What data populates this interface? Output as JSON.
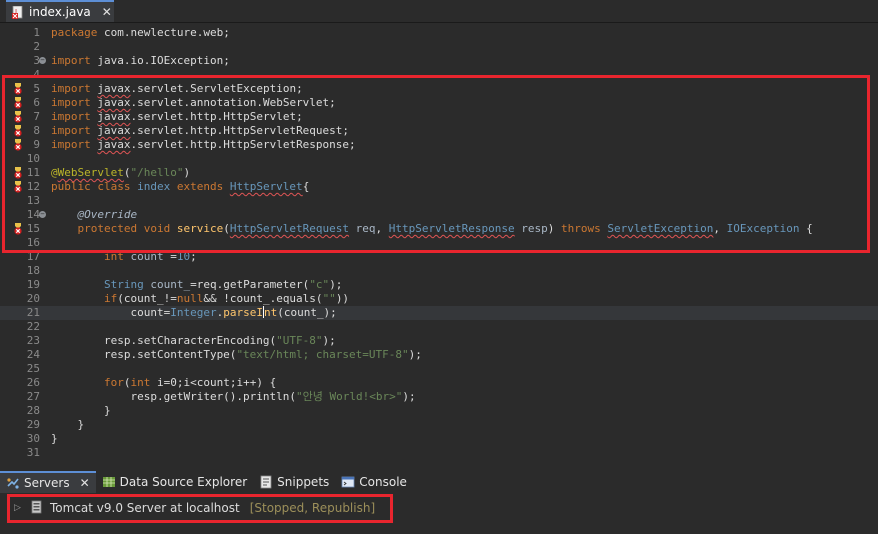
{
  "editor_tab": {
    "filename": "index.java"
  },
  "code_lines": [
    {
      "n": "1",
      "segs": [
        [
          "kw",
          "package"
        ],
        [
          "plain",
          " com.newlecture.web;"
        ]
      ]
    },
    {
      "n": "2",
      "segs": []
    },
    {
      "n": "3",
      "fold": true,
      "segs": [
        [
          "kw",
          "import"
        ],
        [
          "plain",
          " java.io.IOException;"
        ]
      ]
    },
    {
      "n": "4",
      "segs": []
    },
    {
      "n": "5",
      "err": true,
      "segs": [
        [
          "kw",
          "import"
        ],
        [
          "plain",
          " "
        ],
        [
          "plain_squig",
          "javax"
        ],
        [
          "plain",
          ".servlet.ServletException;"
        ]
      ]
    },
    {
      "n": "6",
      "err": true,
      "segs": [
        [
          "kw",
          "import"
        ],
        [
          "plain",
          " "
        ],
        [
          "plain_squig",
          "javax"
        ],
        [
          "plain",
          ".servlet.annotation.WebServlet;"
        ]
      ]
    },
    {
      "n": "7",
      "err": true,
      "segs": [
        [
          "kw",
          "import"
        ],
        [
          "plain",
          " "
        ],
        [
          "plain_squig",
          "javax"
        ],
        [
          "plain",
          ".servlet.http.HttpServlet;"
        ]
      ]
    },
    {
      "n": "8",
      "err": true,
      "segs": [
        [
          "kw",
          "import"
        ],
        [
          "plain",
          " "
        ],
        [
          "plain_squig",
          "javax"
        ],
        [
          "plain",
          ".servlet.http.HttpServletRequest;"
        ]
      ]
    },
    {
      "n": "9",
      "err": true,
      "segs": [
        [
          "kw",
          "import"
        ],
        [
          "plain",
          " "
        ],
        [
          "plain_squig",
          "javax"
        ],
        [
          "plain",
          ".servlet.http.HttpServletResponse;"
        ]
      ]
    },
    {
      "n": "10",
      "segs": []
    },
    {
      "n": "11",
      "err": true,
      "segs": [
        [
          "ann",
          "@"
        ],
        [
          "ann_squig",
          "WebServlet"
        ],
        [
          "plain",
          "("
        ],
        [
          "str",
          "\"/hello\""
        ],
        [
          "plain",
          ")"
        ]
      ]
    },
    {
      "n": "12",
      "err": true,
      "segs": [
        [
          "kw",
          "public class "
        ],
        [
          "type",
          "index"
        ],
        [
          "kw",
          " extends "
        ],
        [
          "type_squig",
          "HttpServlet"
        ],
        [
          "plain",
          "{"
        ]
      ]
    },
    {
      "n": "13",
      "segs": []
    },
    {
      "n": "14",
      "fold": true,
      "segs": [
        [
          "plain",
          "    "
        ],
        [
          "ital",
          "@Override"
        ]
      ]
    },
    {
      "n": "15",
      "err": true,
      "segs": [
        [
          "kw",
          "    protected void "
        ],
        [
          "meth",
          "service"
        ],
        [
          "plain",
          "("
        ],
        [
          "type_squig",
          "HttpServletRequest"
        ],
        [
          "var",
          " req"
        ],
        [
          "plain",
          ", "
        ],
        [
          "type_squig",
          "HttpServletResponse"
        ],
        [
          "var",
          " resp"
        ],
        [
          "plain",
          ") "
        ],
        [
          "kw",
          "throws "
        ],
        [
          "type_squig",
          "ServletException"
        ],
        [
          "plain",
          ", "
        ],
        [
          "type",
          "IOException"
        ],
        [
          "plain",
          " {"
        ]
      ]
    },
    {
      "n": "16",
      "segs": []
    },
    {
      "n": "17",
      "segs": [
        [
          "kw",
          "        int "
        ],
        [
          "var",
          "count"
        ],
        [
          "plain",
          " ="
        ],
        [
          "type",
          "10"
        ],
        [
          "plain",
          ";"
        ]
      ]
    },
    {
      "n": "18",
      "segs": []
    },
    {
      "n": "19",
      "segs": [
        [
          "type",
          "        String "
        ],
        [
          "var",
          "count_"
        ],
        [
          "plain",
          "=req.getParameter("
        ],
        [
          "str",
          "\"c\""
        ],
        [
          "plain",
          ");"
        ]
      ]
    },
    {
      "n": "20",
      "segs": [
        [
          "kw",
          "        if"
        ],
        [
          "plain",
          "(count_!="
        ],
        [
          "kw",
          "null"
        ],
        [
          "plain",
          "&& !count_.equals("
        ],
        [
          "str",
          "\"\""
        ],
        [
          "plain",
          "))"
        ]
      ]
    },
    {
      "n": "21",
      "current": true,
      "segs": [
        [
          "plain",
          "            count="
        ],
        [
          "type",
          "Integer"
        ],
        [
          "plain",
          "."
        ],
        [
          "meth",
          "parseI"
        ],
        [
          "cursor",
          ""
        ],
        [
          "meth",
          "nt"
        ],
        [
          "plain",
          "(count_);"
        ]
      ]
    },
    {
      "n": "22",
      "segs": []
    },
    {
      "n": "23",
      "segs": [
        [
          "plain",
          "        resp.setCharacterEncoding("
        ],
        [
          "str",
          "\"UTF-8\""
        ],
        [
          "plain",
          ");"
        ]
      ]
    },
    {
      "n": "24",
      "segs": [
        [
          "plain",
          "        resp.setContentType("
        ],
        [
          "str",
          "\"text/html; charset=UTF-8\""
        ],
        [
          "plain",
          ");"
        ]
      ]
    },
    {
      "n": "25",
      "segs": []
    },
    {
      "n": "26",
      "segs": [
        [
          "kw",
          "        for"
        ],
        [
          "plain",
          "("
        ],
        [
          "kw",
          "int "
        ],
        [
          "plain",
          "i=0;i<count;i++) {"
        ]
      ]
    },
    {
      "n": "27",
      "segs": [
        [
          "plain",
          "            resp.getWriter().println("
        ],
        [
          "str",
          "\"안녕 World!<br>\""
        ],
        [
          "plain",
          ");"
        ]
      ]
    },
    {
      "n": "28",
      "segs": [
        [
          "plain",
          "        }"
        ]
      ]
    },
    {
      "n": "29",
      "segs": [
        [
          "plain",
          "    }"
        ]
      ]
    },
    {
      "n": "30",
      "segs": [
        [
          "plain",
          "}"
        ]
      ]
    },
    {
      "n": "31",
      "segs": []
    }
  ],
  "bottom_tabs": [
    {
      "label": "Servers",
      "icon": "servers-icon",
      "active": true,
      "closable": true
    },
    {
      "label": "Data Source Explorer",
      "icon": "data-source-icon"
    },
    {
      "label": "Snippets",
      "icon": "snippets-icon"
    },
    {
      "label": "Console",
      "icon": "console-icon"
    }
  ],
  "server_entry": {
    "name": "Tomcat v9.0 Server at localhost",
    "status": "[Stopped, Republish]"
  },
  "colors": {
    "highlight_border": "#e8252e",
    "keyword": "#cc7832",
    "string": "#6a8759",
    "type": "#6897bb"
  }
}
